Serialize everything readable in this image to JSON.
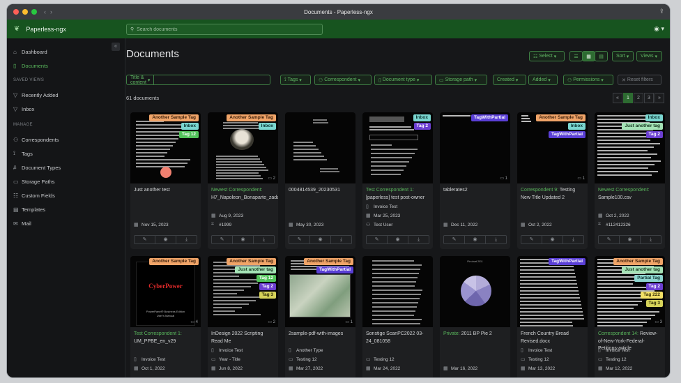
{
  "window": {
    "title": "Documents - Paperless-ngx"
  },
  "app": {
    "name": "Paperless-ngx",
    "search_placeholder": "Search documents"
  },
  "sidebar": {
    "items": [
      {
        "label": "Dashboard",
        "icon": "house-icon"
      },
      {
        "label": "Documents",
        "icon": "file-icon",
        "active": true
      }
    ],
    "saved_views_heading": "SAVED VIEWS",
    "saved_views": [
      {
        "label": "Recently Added",
        "icon": "funnel-icon"
      },
      {
        "label": "Inbox",
        "icon": "funnel-icon"
      }
    ],
    "manage_heading": "MANAGE",
    "manage": [
      {
        "label": "Correspondents",
        "icon": "person-icon",
        "glyph": "⚇"
      },
      {
        "label": "Tags",
        "icon": "tag-icon",
        "glyph": "⟟"
      },
      {
        "label": "Document Types",
        "icon": "hash-icon",
        "glyph": "#"
      },
      {
        "label": "Storage Paths",
        "icon": "folder-icon",
        "glyph": "▭"
      },
      {
        "label": "Custom Fields",
        "icon": "ui-radios-icon",
        "glyph": "☷"
      },
      {
        "label": "Templates",
        "icon": "file-text-icon",
        "glyph": "▤"
      },
      {
        "label": "Mail",
        "icon": "envelope-icon",
        "glyph": "✉"
      }
    ]
  },
  "page": {
    "title": "Documents",
    "count": "61 documents",
    "select_label": "Select",
    "sort_label": "Sort",
    "views_label": "Views"
  },
  "filters": {
    "title_content": "Title & content",
    "tags": "Tags",
    "correspondent": "Correspondent",
    "document_type": "Document type",
    "storage_path": "Storage path",
    "created": "Created",
    "added": "Added",
    "permissions": "Permissions",
    "reset": "Reset filters"
  },
  "pagination": {
    "prev": "«",
    "pages": [
      "1",
      "2",
      "3"
    ],
    "next": "»",
    "current": "1"
  },
  "tag_colors": {
    "Another Sample Tag": {
      "bg": "#f0a468",
      "fg": "#3b1e0a"
    },
    "Inbox": {
      "bg": "#7ad6d0",
      "fg": "#0c3533"
    },
    "Tag 12": {
      "bg": "#52c25a",
      "fg": "#ffffff"
    },
    "Tag 2": {
      "bg": "#6c3fd1",
      "fg": "#ffffff"
    },
    "TagWithPartial": {
      "bg": "#5a3fd6",
      "fg": "#ffffff"
    },
    "Just another tag": {
      "bg": "#a5e3b6",
      "fg": "#16361f"
    },
    "Tag 3": {
      "bg": "#d6d35a",
      "fg": "#2c2a05"
    },
    "Partial Tag": {
      "bg": "#8ed6cf",
      "fg": "#0f3330"
    },
    "Tag 222": {
      "bg": "#f2e066",
      "fg": "#3a3205"
    }
  },
  "documents": [
    {
      "thumb": "doc_orb",
      "tags": [
        "Another Sample Tag",
        "Inbox",
        "Tag 12"
      ],
      "correspondent": "",
      "title": "Just another test",
      "meta": [
        {
          "icon": "calendar-icon",
          "glyph": "▦",
          "text": "Nov 15, 2023"
        }
      ],
      "notes": ""
    },
    {
      "thumb": "doc_portrait",
      "tags": [
        "Another Sample Tag",
        "Inbox"
      ],
      "correspondent": "Newest Correspondent:",
      "title": "H7_Napoleon_Bonaparte_zadanie",
      "meta": [
        {
          "icon": "calendar-icon",
          "glyph": "▦",
          "text": "Aug 9, 2023"
        },
        {
          "icon": "asn-icon",
          "glyph": "⌗",
          "text": "#1999"
        }
      ],
      "notes": "2"
    },
    {
      "thumb": "doc_letter",
      "tags": [],
      "correspondent": "",
      "title": "0004814539_20230531",
      "meta": [
        {
          "icon": "calendar-icon",
          "glyph": "▦",
          "text": "May 30, 2023"
        }
      ],
      "notes": ""
    },
    {
      "thumb": "doc_form",
      "tags": [
        "Inbox",
        "Tag 2"
      ],
      "correspondent": "Test Correspondent 1:",
      "title": "[paperless] test post-owner",
      "meta": [
        {
          "icon": "doctype-icon",
          "glyph": "▯",
          "text": "Invoice Test"
        },
        {
          "icon": "calendar-icon",
          "glyph": "▦",
          "text": "Mar 25, 2023"
        },
        {
          "icon": "owner-icon",
          "glyph": "⚇",
          "text": "Test User"
        }
      ],
      "notes": ""
    },
    {
      "thumb": "doc_table",
      "tags": [
        "TagWithPartial"
      ],
      "correspondent": "",
      "title": "tablerates2",
      "meta": [
        {
          "icon": "calendar-icon",
          "glyph": "▦",
          "text": "Dec 11, 2022"
        }
      ],
      "notes": "1"
    },
    {
      "thumb": "doc_note",
      "tags": [
        "Another Sample Tag",
        "Inbox",
        "TagWithPartial"
      ],
      "correspondent": "Correspondent 9:",
      "title": "Testing New Title Updated 2",
      "meta": [
        {
          "icon": "calendar-icon",
          "glyph": "▦",
          "text": "Oct 2, 2022"
        }
      ],
      "notes": "1"
    },
    {
      "thumb": "doc_csv",
      "tags": [
        "Inbox",
        "Just another tag",
        "Tag 2"
      ],
      "correspondent": "Newest Correspondent:",
      "title": "Sample100.csv",
      "meta": [
        {
          "icon": "calendar-icon",
          "glyph": "▦",
          "text": "Oct 2, 2022"
        },
        {
          "icon": "asn-icon",
          "glyph": "⌗",
          "text": "#112412326"
        }
      ],
      "notes": ""
    },
    {
      "thumb": "doc_cyber",
      "tags": [
        "Another Sample Tag"
      ],
      "correspondent": "Test Correspondent 1:",
      "title": "UM_PPBE_en_v29",
      "meta": [
        {
          "icon": "doctype-icon",
          "glyph": "▯",
          "text": "Invoice Test"
        },
        {
          "icon": "calendar-icon",
          "glyph": "▦",
          "text": "Oct 1, 2022"
        }
      ],
      "notes": "4"
    },
    {
      "thumb": "doc_indesign",
      "tags": [
        "Another Sample Tag",
        "Just another tag",
        "Tag 12",
        "Tag 2",
        "Tag 3"
      ],
      "correspondent": "",
      "title": "InDesign 2022 Scripting Read Me",
      "meta": [
        {
          "icon": "doctype-icon",
          "glyph": "▯",
          "text": "Invoice Test"
        },
        {
          "icon": "storage-icon",
          "glyph": "▭",
          "text": "Year - Title"
        },
        {
          "icon": "calendar-icon",
          "glyph": "▦",
          "text": "Jun 8, 2022"
        }
      ],
      "notes": "2"
    },
    {
      "thumb": "doc_map",
      "tags": [
        "Another Sample Tag",
        "TagWithPartial"
      ],
      "correspondent": "",
      "title": "2sample-pdf-with-images",
      "meta": [
        {
          "icon": "doctype-icon",
          "glyph": "▯",
          "text": "Another Type"
        },
        {
          "icon": "storage-icon",
          "glyph": "▭",
          "text": "Testing 12"
        },
        {
          "icon": "calendar-icon",
          "glyph": "▦",
          "text": "Mar 27, 2022"
        }
      ],
      "notes": "1"
    },
    {
      "thumb": "doc_lines",
      "tags": [],
      "correspondent": "",
      "title": "Sonstige ScanPC2022 03-24_081058",
      "meta": [
        {
          "icon": "storage-icon",
          "glyph": "▭",
          "text": "Testing 12"
        },
        {
          "icon": "calendar-icon",
          "glyph": "▦",
          "text": "Mar 24, 2022"
        }
      ],
      "notes": ""
    },
    {
      "thumb": "doc_pie",
      "tags": [],
      "correspondent": "Private:",
      "title": "2011 BP Pie 2",
      "meta": [
        {
          "icon": "calendar-icon",
          "glyph": "▦",
          "text": "Mar 16, 2022"
        }
      ],
      "notes": ""
    },
    {
      "thumb": "doc_dense",
      "tags": [
        "TagWithPartial"
      ],
      "correspondent": "",
      "title": "French Country Bread Revised.docx",
      "meta": [
        {
          "icon": "doctype-icon",
          "glyph": "▯",
          "text": "Invoice Test"
        },
        {
          "icon": "storage-icon",
          "glyph": "▭",
          "text": "Testing 12"
        },
        {
          "icon": "calendar-icon",
          "glyph": "▦",
          "text": "Mar 13, 2022"
        }
      ],
      "notes": ""
    },
    {
      "thumb": "doc_news",
      "tags": [
        "Another Sample Tag",
        "Just another tag",
        "Partial Tag",
        "Tag 2",
        "Tag 222",
        "Tag 3"
      ],
      "correspondent": "Correspondent 14:",
      "title": "Review-of-New-York-Federal-Petitions-article",
      "meta": [
        {
          "icon": "doctype-icon",
          "glyph": "▯",
          "text": "Invoice Test"
        },
        {
          "icon": "storage-icon",
          "glyph": "▭",
          "text": "Testing 12"
        },
        {
          "icon": "calendar-icon",
          "glyph": "▦",
          "text": "Mar 12, 2022"
        }
      ],
      "notes": "3"
    }
  ],
  "thumb_text": {
    "cyber": "CyberPower",
    "cyber_sub": "PowerPanel® Business Edition",
    "cyber_sub2": "User's Manual",
    "pie_title": "Pie chart 2011"
  }
}
